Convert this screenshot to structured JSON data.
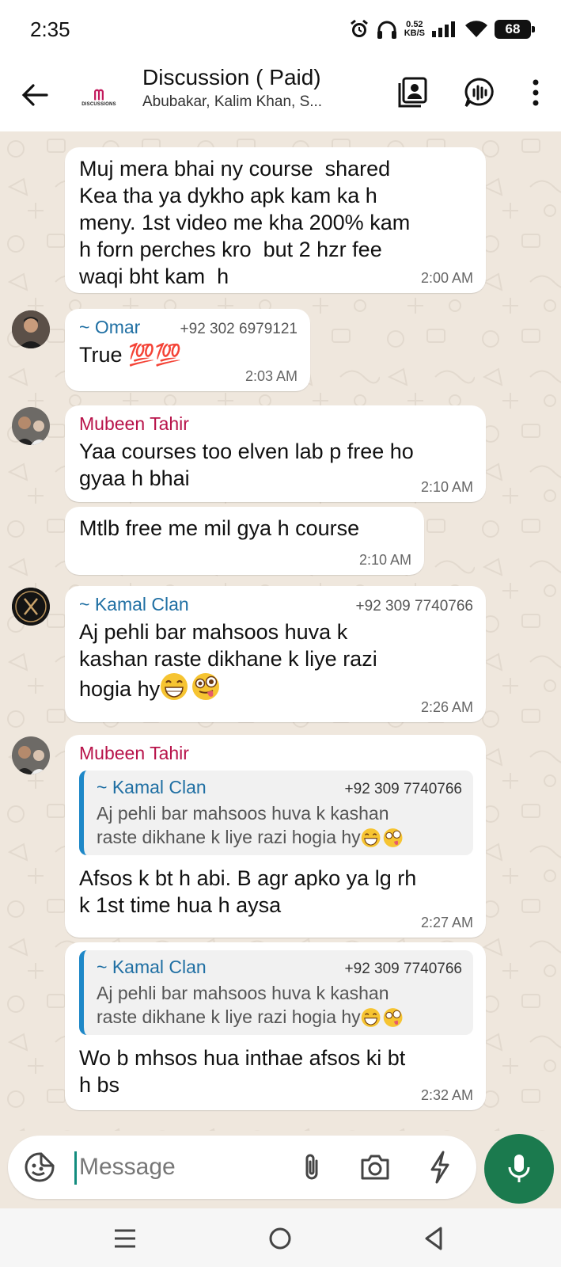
{
  "status_bar": {
    "time": "2:35",
    "net_speed_value": "0.52",
    "net_speed_unit": "KB/S",
    "battery": "68"
  },
  "header": {
    "title": "Discussion ( Paid)",
    "subtitle": "Abubakar, Kalim Khan, S...",
    "group_logo_text": "DISCUSSIONS"
  },
  "messages": {
    "m1": {
      "text": "Muj mera bhai ny course  shared\nKea tha ya dykho apk kam ka h\nmeny. 1st video me kha 200% kam\nh forn perches kro  but 2 hzr fee\nwaqi bht kam  h",
      "time": "2:00 AM"
    },
    "m2": {
      "sender": "~ Omar",
      "phone": "+92 302 6979121",
      "text": "True 💯💯",
      "time": "2:03 AM"
    },
    "m3": {
      "sender": "Mubeen Tahir",
      "text": "Yaa courses too elven lab p free ho\ngyaa h bhai",
      "time": "2:10 AM"
    },
    "m4": {
      "text": "Mtlb free me mil gya h course",
      "time": "2:10 AM"
    },
    "m5": {
      "sender": "~ Kamal Clan",
      "phone": "+92 309 7740766",
      "text": "Aj pehli bar mahsoos huva k\nkashan raste dikhane k liye razi\nhogia hy",
      "time": "2:26 AM"
    },
    "m6": {
      "sender": "Mubeen Tahir",
      "quote_sender": "~ Kamal Clan",
      "quote_phone": "+92 309 7740766",
      "quote_text": "Aj pehli bar mahsoos huva k kashan\nraste dikhane k liye razi hogia hy",
      "text": "Afsos k bt h abi. B agr apko ya lg rh\nk 1st time hua h aysa",
      "time": "2:27 AM"
    },
    "m7": {
      "quote_sender": "~ Kamal Clan",
      "quote_phone": "+92 309 7740766",
      "quote_text": "Aj pehli bar mahsoos huva k kashan\nraste dikhane k liye razi hogia hy",
      "text": "Wo b mhsos hua inthae afsos ki bt\nh bs",
      "time": "2:32 AM"
    }
  },
  "composer": {
    "placeholder": "Message"
  },
  "colors": {
    "wallpaper": "#efe7dd",
    "mubeen": "#b8134a",
    "omar": "#1f6fa3",
    "kamal": "#1f6fa3",
    "mic": "#1b7a4e"
  },
  "icons": [
    "back-arrow-icon",
    "contact-card-icon",
    "voice-chat-icon",
    "more-vert-icon",
    "sticker-icon",
    "paperclip-icon",
    "camera-icon",
    "bolt-icon",
    "mic-icon"
  ]
}
